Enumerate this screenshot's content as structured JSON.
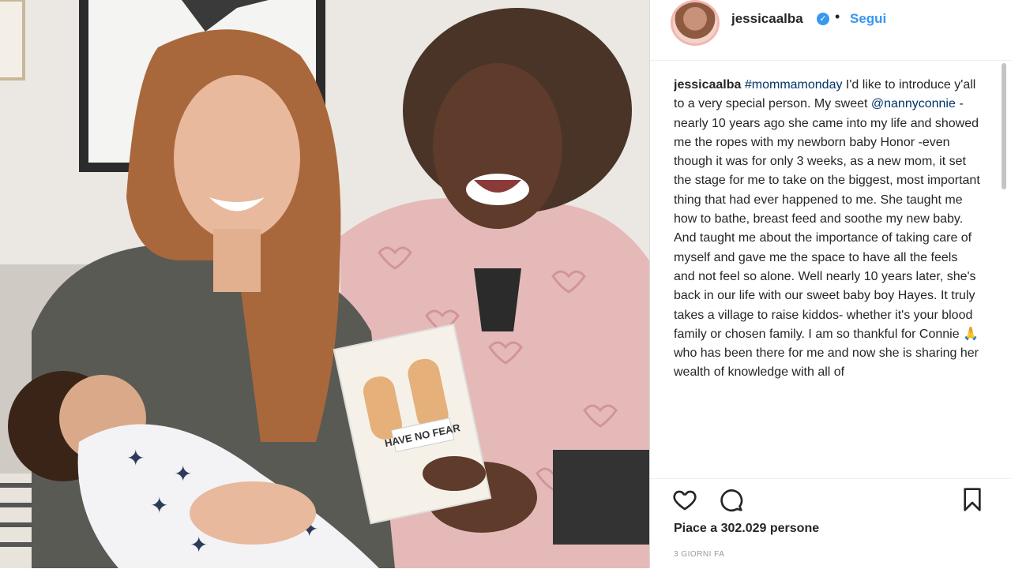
{
  "post": {
    "username": "jessicaalba",
    "verified_badge": "verified-check-icon",
    "separator": "•",
    "follow_label": "Segui",
    "caption": {
      "username": "jessicaalba",
      "hashtag": "#mommamonday",
      "text_1": " I'd like to introduce y'all to a very special person. My sweet ",
      "mention": "@nannyconnie",
      "text_2": " -nearly 10 years ago she came into my life and showed me the ropes with my newborn baby Honor -even though it was for only 3 weeks, as a new mom, it set the stage for me to take on the biggest, most important thing that had ever happened to me. She taught me how to bathe, breast feed and soothe my new baby. And taught me about the importance of taking care of myself and gave me the space to have all the feels and not feel so alone. Well nearly 10 years later, she's back in our life with our sweet baby boy Hayes. It truly takes a village to raise kiddos- whether it's your blood family or chosen family. I am so thankful for Connie ",
      "emoji": "🙏",
      "text_3": " who has been there for me and now she is sharing her wealth of knowledge with all of"
    },
    "likes_text": "Piace a 302.029 persone",
    "time_ago": "3 GIORNI FA"
  },
  "photo": {
    "book_title": "HAVE NO FEAR"
  },
  "icons": {
    "like": "heart-icon",
    "comment": "comment-icon",
    "save": "bookmark-icon"
  },
  "colors": {
    "link": "#003569",
    "follow": "#3897f0",
    "text": "#262626"
  }
}
